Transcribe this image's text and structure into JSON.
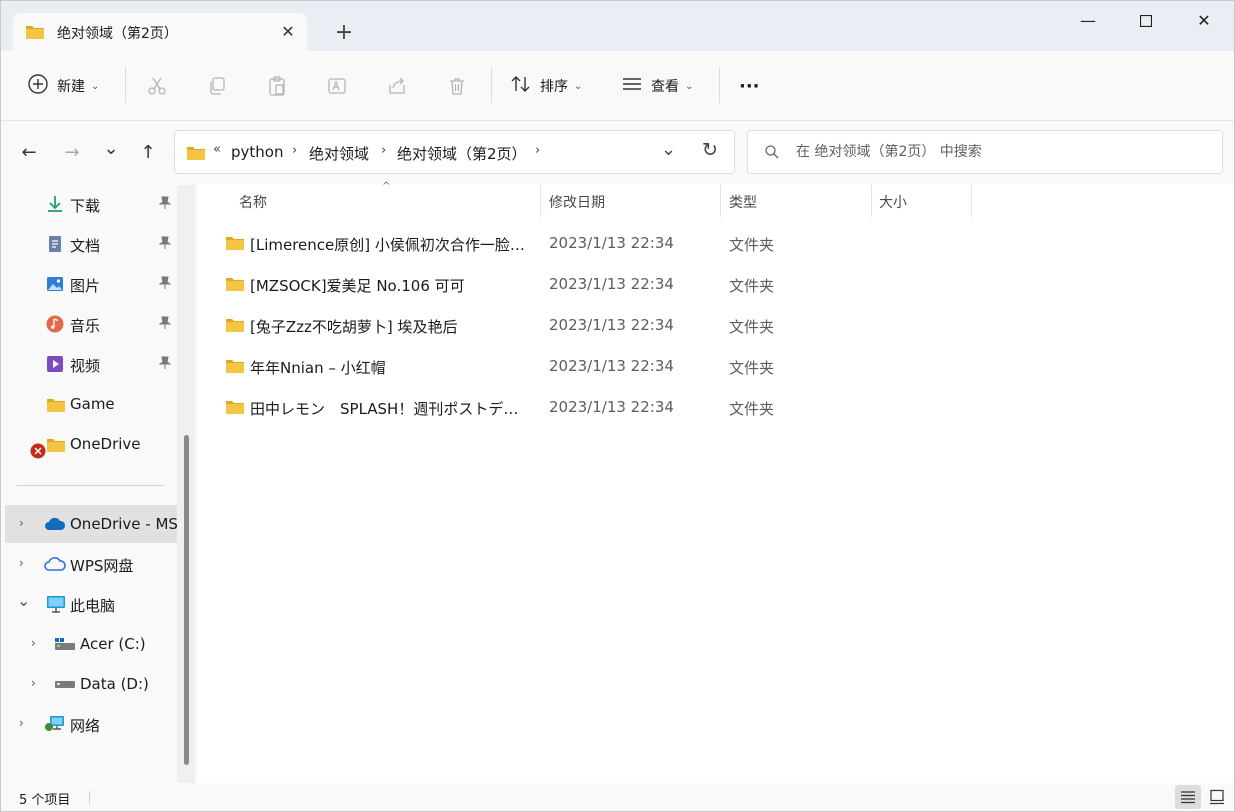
{
  "window": {
    "tab_title": "绝对领域（第2页）",
    "tab_close": "✕",
    "new_tab": "+",
    "minimize": "—",
    "maximize": "☐",
    "close": "✕"
  },
  "toolbar": {
    "new_label": "新建",
    "sort_label": "排序",
    "view_label": "查看",
    "more_label": "···",
    "icons": [
      "cut-icon",
      "copy-icon",
      "paste-icon",
      "rename-icon",
      "share-icon",
      "delete-icon"
    ]
  },
  "nav": {
    "back": "←",
    "forward": "→",
    "recent": "⌄",
    "up": "↑",
    "overflow": "«",
    "crumbs": [
      "python",
      "绝对领域",
      "绝对领域（第2页）"
    ],
    "crumb_sep": "›",
    "refresh": "↻",
    "dropdown": "⌄"
  },
  "search": {
    "placeholder": "在 绝对领域（第2页） 中搜索"
  },
  "sidebar": {
    "quick_access": [
      {
        "label": "下载",
        "icon": "download-icon",
        "pinned": true
      },
      {
        "label": "文档",
        "icon": "document-icon",
        "pinned": true
      },
      {
        "label": "图片",
        "icon": "pictures-icon",
        "pinned": true
      },
      {
        "label": "音乐",
        "icon": "music-icon",
        "pinned": true
      },
      {
        "label": "视频",
        "icon": "video-icon",
        "pinned": true
      },
      {
        "label": "Game",
        "icon": "folder-icon",
        "pinned": false
      },
      {
        "label": "OneDrive",
        "icon": "folder-icon",
        "pinned": false,
        "error": true
      }
    ],
    "tree": [
      {
        "label": "OneDrive - MS",
        "icon": "onedrive-cloud-icon",
        "expanded": false,
        "active": true
      },
      {
        "label": "WPS网盘",
        "icon": "wps-cloud-icon",
        "expanded": false
      },
      {
        "label": "此电脑",
        "icon": "this-pc-icon",
        "expanded": true
      },
      {
        "label": "Acer (C:)",
        "icon": "drive-c-icon",
        "expanded": false,
        "indent": true
      },
      {
        "label": "Data (D:)",
        "icon": "drive-d-icon",
        "expanded": false,
        "indent": true
      },
      {
        "label": "网络",
        "icon": "network-icon",
        "expanded": false
      }
    ],
    "pin_glyph": "📌",
    "chev_right": "›",
    "chev_down": "⌄"
  },
  "columns": {
    "name": "名称",
    "date": "修改日期",
    "type": "类型",
    "size": "大小",
    "sort_indicator": "^"
  },
  "files": [
    {
      "name": "[Limerence原创] 小侯佩初次合作一脸羞涩",
      "date": "2023/1/13 22:34",
      "type": "文件夹"
    },
    {
      "name": "[MZSOCK]爱美足 No.106 可可",
      "date": "2023/1/13 22:34",
      "type": "文件夹"
    },
    {
      "name": "[兔子Zzz不吃胡萝卜] 埃及艳后",
      "date": "2023/1/13 22:34",
      "type": "文件夹"
    },
    {
      "name": "年年Nnian – 小红帽",
      "date": "2023/1/13 22:34",
      "type": "文件夹"
    },
    {
      "name": "田中レモン　SPLASH！週刊ポストデジタル写真集",
      "date": "2023/1/13 22:34",
      "type": "文件夹"
    }
  ],
  "status": {
    "item_count": "5 个项目"
  },
  "colors": {
    "folder": "#f4c542",
    "folder_dark": "#e0a820",
    "accent": "#0067c0",
    "error": "#c42b1c"
  }
}
